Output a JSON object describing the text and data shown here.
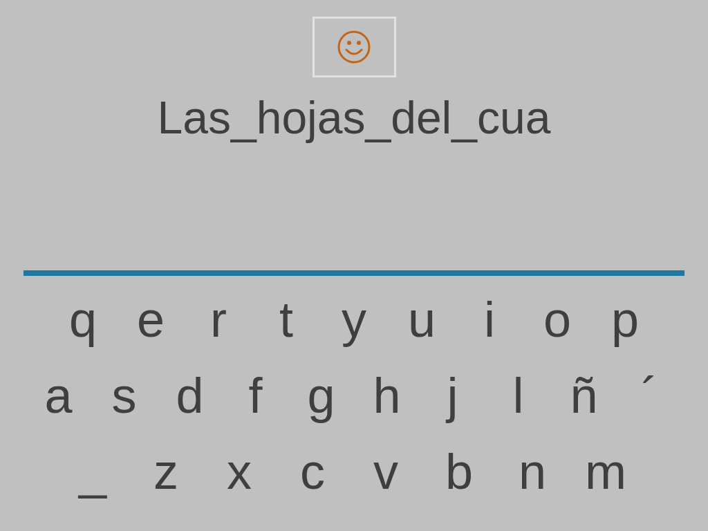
{
  "prompt": "Las_hojas_del_cua",
  "keyboard": {
    "rows": [
      [
        "q",
        "e",
        "r",
        "t",
        "y",
        "u",
        "i",
        "o",
        "p"
      ],
      [
        "a",
        "s",
        "d",
        "f",
        "g",
        "h",
        "j",
        "l",
        "ñ",
        "´"
      ],
      [
        "_",
        "z",
        "x",
        "c",
        "v",
        "b",
        "n",
        "m"
      ]
    ]
  }
}
